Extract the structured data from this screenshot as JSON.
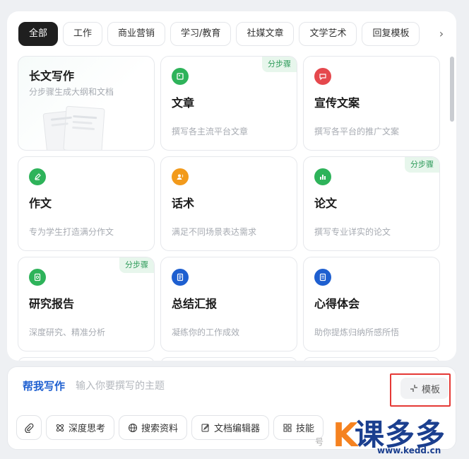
{
  "tabs": [
    "全部",
    "工作",
    "商业营销",
    "学习/教育",
    "社媒文章",
    "文学艺术",
    "回复模板"
  ],
  "cards": [
    {
      "title": "长文写作",
      "desc": "分步骤生成大纲和文档",
      "badge": "",
      "icon": "document-illustration",
      "color": "#2eb35a"
    },
    {
      "title": "文章",
      "desc": "撰写各主流平台文章",
      "badge": "分步骤",
      "icon": "image-icon",
      "color": "#2eb35a"
    },
    {
      "title": "宣传文案",
      "desc": "撰写各平台的推广文案",
      "badge": "",
      "icon": "message-icon",
      "color": "#e5484d"
    },
    {
      "title": "作文",
      "desc": "专为学生打造满分作文",
      "badge": "",
      "icon": "pen-icon",
      "color": "#2eb35a"
    },
    {
      "title": "话术",
      "desc": "满足不同场景表达需求",
      "badge": "",
      "icon": "speaker-icon",
      "color": "#f29a1b"
    },
    {
      "title": "论文",
      "desc": "撰写专业详实的论文",
      "badge": "分步骤",
      "icon": "chart-icon",
      "color": "#2eb35a"
    },
    {
      "title": "研究报告",
      "desc": "深度研究、精准分析",
      "badge": "分步骤",
      "icon": "report-icon",
      "color": "#2eb35a"
    },
    {
      "title": "总结汇报",
      "desc": "凝练你的工作成效",
      "badge": "",
      "icon": "notebook-icon",
      "color": "#1e5fd0"
    },
    {
      "title": "心得体会",
      "desc": "助你提炼归纳所感所悟",
      "badge": "",
      "icon": "note-icon",
      "color": "#1e5fd0"
    }
  ],
  "composer": {
    "label": "帮我写作",
    "placeholder": "输入你要撰写的主题",
    "template_label": "模板"
  },
  "tools": [
    "深度思考",
    "搜索资料",
    "文档编辑器",
    "技能"
  ],
  "watermark": {
    "logo_k": "K",
    "logo_text": "课多多",
    "url": "www.kedd.cn",
    "wechat": "号"
  }
}
